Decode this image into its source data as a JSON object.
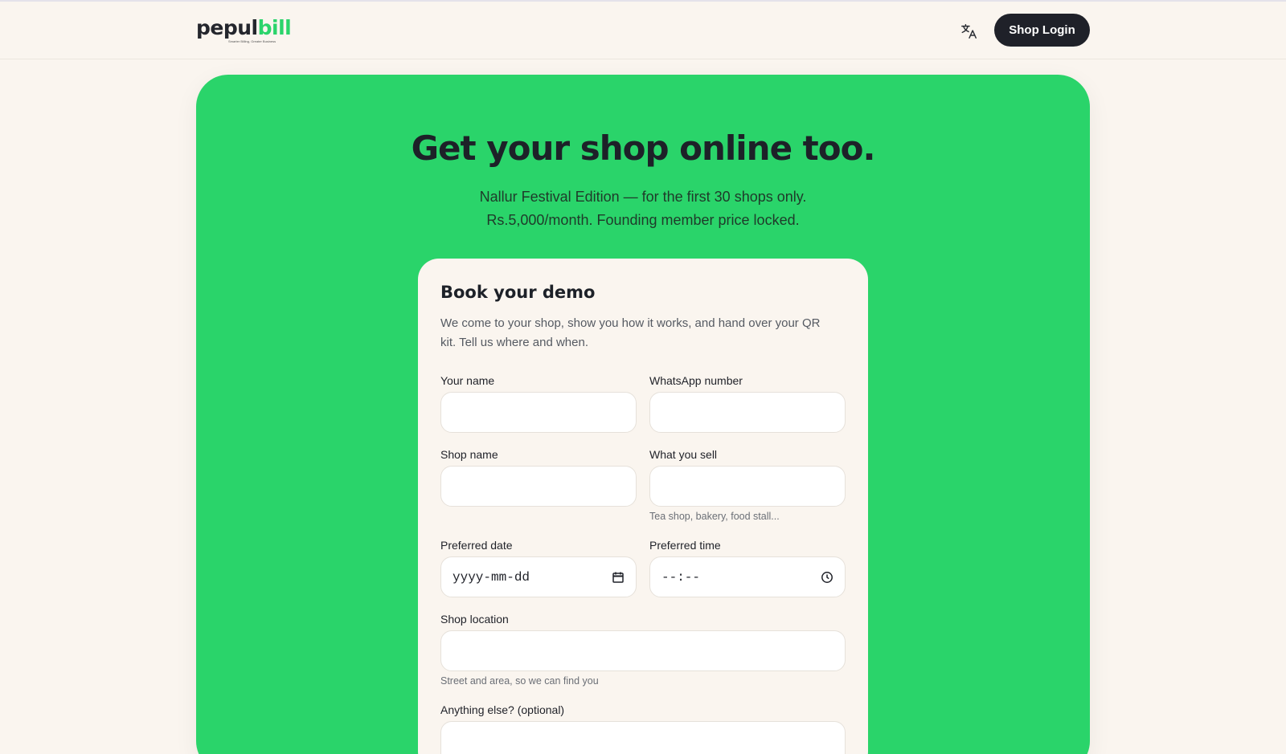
{
  "header": {
    "logo": {
      "word_part1": "pepul",
      "word_part2": "bill",
      "tagline": "Smarter Billing, Greater Business"
    },
    "translate_icon": "translate-icon",
    "login_label": "Shop Login"
  },
  "hero": {
    "title": "Get your shop online too.",
    "subtitle_line1": "Nallur Festival Edition — for the first 30 shops only.",
    "subtitle_line2": "Rs.5,000/month. Founding member price locked."
  },
  "form": {
    "title": "Book your demo",
    "description": "We come to your shop, show you how it works, and hand over your QR kit. Tell us where and when.",
    "fields": {
      "name": {
        "label": "Your name",
        "value": ""
      },
      "whatsapp": {
        "label": "WhatsApp number",
        "value": ""
      },
      "shop_name": {
        "label": "Shop name",
        "value": ""
      },
      "what_you_sell": {
        "label": "What you sell",
        "value": "",
        "hint": "Tea shop, bakery, food stall..."
      },
      "preferred_date": {
        "label": "Preferred date",
        "placeholder": "yyyy-mm-dd",
        "icon": "calendar-icon"
      },
      "preferred_time": {
        "label": "Preferred time",
        "placeholder": "--:--",
        "icon": "clock-icon"
      },
      "shop_location": {
        "label": "Shop location",
        "value": "",
        "hint": "Street and area, so we can find you"
      },
      "anything_else": {
        "label": "Anything else? (optional)",
        "value": ""
      }
    }
  },
  "colors": {
    "page_bg": "#faf5ef",
    "hero_green": "#2ad46a",
    "dark": "#1f2129",
    "brand_green": "#2bd46b"
  }
}
